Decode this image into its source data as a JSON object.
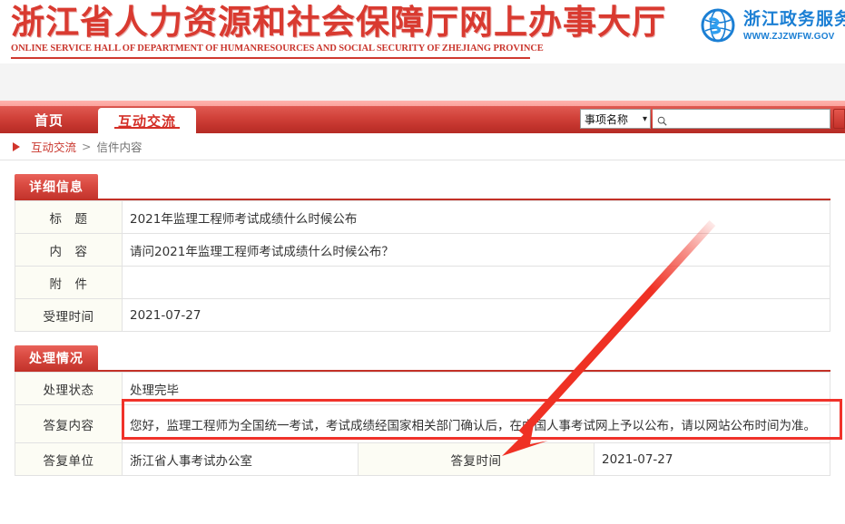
{
  "header": {
    "site_title_cn": "浙江省人力资源和社会保障厅网上办事大厅",
    "site_title_en": "ONLINE SERVICE HALL OF DEPARTMENT OF HUMANRESOURCES AND SOCIAL SECURITY OF ZHEJIANG PROVINCE",
    "gov_logo_cn": "浙江政务服务",
    "gov_logo_url": "WWW.ZJZWFW.GOV",
    "logo_icon": "zhejiang-gov-globe-icon",
    "brand_color": "#cf3a30",
    "gov_logo_color": "#1b7fd4"
  },
  "nav": {
    "items": [
      {
        "label": "首页",
        "active": false
      },
      {
        "label": "互动交流",
        "active": true
      }
    ],
    "search": {
      "category_selected": "事项名称",
      "category_options": [
        "事项名称"
      ],
      "placeholder": "",
      "value": "",
      "search_icon": "magnifier-icon",
      "chevron_icon": "chevron-down-icon"
    }
  },
  "breadcrumb": {
    "marker_icon": "triangle-right-icon",
    "parent": "互动交流",
    "separator": ">",
    "current": "信件内容"
  },
  "sections": [
    {
      "title": "详细信息",
      "rows": [
        {
          "label": "标　题",
          "value": "2021年监理工程师考试成绩什么时候公布"
        },
        {
          "label": "内　容",
          "value": "请问2021年监理工程师考试成绩什么时候公布？"
        },
        {
          "label": "附　件",
          "value": ""
        },
        {
          "label": "受理时间",
          "value": "2021-07-27"
        }
      ]
    },
    {
      "title": "处理情况",
      "rows": [
        {
          "label": "处理状态",
          "value": "处理完毕"
        },
        {
          "label": "答复内容",
          "value": "您好，监理工程师为全国统一考试，考试成绩经国家相关部门确认后，在中国人事考试网上予以公布，请以网站公布时间为准。",
          "highlighted": true
        },
        {
          "label": "答复单位",
          "value": "浙江省人事考试办公室",
          "label2": "答复时间",
          "value2": "2021-07-27"
        }
      ]
    }
  ],
  "annotation": {
    "arrow_color": "#ef3124",
    "highlight_color": "#f0322a",
    "arrow_from": "783,248",
    "arrow_to": "553,503"
  }
}
